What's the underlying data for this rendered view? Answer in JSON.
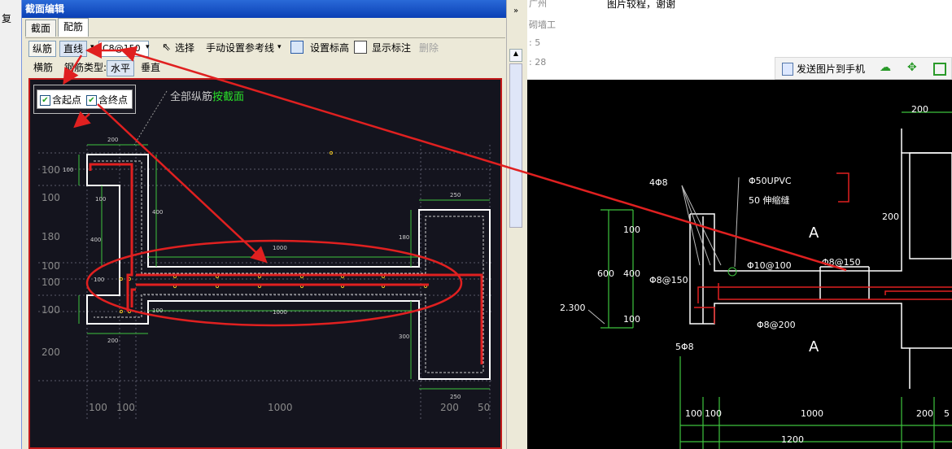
{
  "editor": {
    "title": "截面编辑",
    "tabs": [
      "截面",
      "配筋"
    ],
    "toolbar1": {
      "longitudinal": "纵筋",
      "straight_line": "直线",
      "rebar_spec": "C8@150",
      "select": "选择",
      "manual_ref": "手动设置参考线",
      "set_elevation": "设置标高",
      "show_annotation": "显示标注",
      "delete": "删除"
    },
    "toolbar2": {
      "transverse": "横筋",
      "rebar_type_label": "钢筋类型:",
      "horizontal": "水平",
      "vertical": "垂直"
    },
    "checkboxes": {
      "start": "含起点",
      "end": "含终点"
    },
    "hint_prefix": "全部纵筋",
    "hint_suffix": "按截面",
    "dims": {
      "top_200": "200",
      "right_250": "250",
      "d100_a": "100",
      "d100_b": "100",
      "d400_a": "400",
      "d400_b": "400",
      "d1000_a": "1000",
      "d1000_b": "1000",
      "d180": "180",
      "d300": "300",
      "bottom_200": "200",
      "bottom_250": "250",
      "d100_c": "100",
      "d100_d": "100",
      "left_100_a": "100",
      "left_100_b": "100",
      "left_180": "180",
      "left_100_c": "100",
      "left_100_d": "100",
      "left_100_e": "100",
      "left_200": "200",
      "bot_100_a": "100",
      "bot_100_b": "100",
      "bot_1000": "1000",
      "bot_200": "200",
      "bot_50": "50"
    }
  },
  "left_strip": {
    "item": "复"
  },
  "right": {
    "lines": [
      "广州",
      "砌墙工",
      ": 5",
      ": 28"
    ],
    "thanks": "图片较程，谢谢",
    "send_phone": "发送图片到手机",
    "drawing": {
      "top200": "200",
      "bar4": "4Φ8",
      "pipe": "Φ50UPVC",
      "pipe2": "50 伸缩缝",
      "d200": "200",
      "A1": "A",
      "A2": "A",
      "phi10": "Φ10@100",
      "phi8_150a": "Φ8@150",
      "phi8_150b": "Φ8@150",
      "phi8_200": "Φ8@200",
      "bar5": "5Φ8",
      "elev": "2.300",
      "h600": "600",
      "h100a": "100",
      "h400": "400",
      "h100b": "100",
      "b100a": "100",
      "b100b": "100",
      "b1000": "1000",
      "b200": "200",
      "b5": "5",
      "b1200": "1200"
    }
  }
}
